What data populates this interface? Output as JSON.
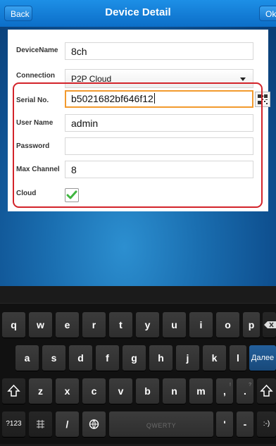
{
  "navbar": {
    "back_label": "Back",
    "title": "Device Detail",
    "ok_label": "Ok"
  },
  "form": {
    "device_name_label": "DeviceName",
    "device_name_value": "8ch",
    "connection_label": "Connection",
    "connection_value": "P2P Cloud",
    "serial_label": "Serial No.",
    "serial_value": "b5021682bf646f12",
    "user_label": "User Name",
    "user_value": "admin",
    "password_label": "Password",
    "password_value": "",
    "max_channel_label": "Max Channel",
    "max_channel_value": "8",
    "cloud_label": "Cloud",
    "cloud_checked": true
  },
  "keyboard": {
    "row1": [
      "q",
      "w",
      "e",
      "r",
      "t",
      "y",
      "u",
      "i",
      "o",
      "p"
    ],
    "row2": [
      "a",
      "s",
      "d",
      "f",
      "g",
      "h",
      "j",
      "k",
      "l"
    ],
    "row3": [
      "z",
      "x",
      "c",
      "v",
      "b",
      "n",
      "m"
    ],
    "enter_label": "Далее",
    "sym_label": "?123",
    "slash_label": "/",
    "space_label": "QWERTY",
    "apostrophe_label": "'",
    "dash_label": "-",
    "smiley_label": ":-)",
    "comma_label": ",",
    "period_label": ".",
    "hint_comma": "!",
    "hint_period": "?"
  },
  "colors": {
    "navbar": "#0c6ec8",
    "highlight": "#d3232a",
    "active_border": "#f29a2e",
    "enter_key": "#235f9b"
  }
}
